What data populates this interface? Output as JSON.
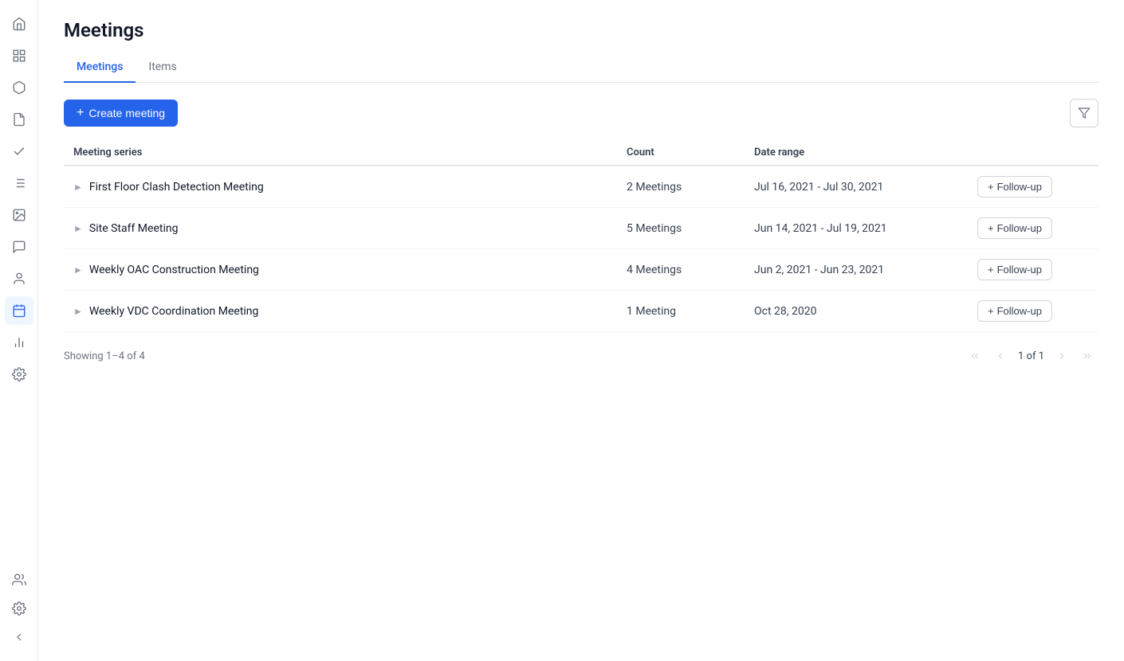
{
  "page": {
    "title": "Meetings"
  },
  "tabs": [
    {
      "id": "meetings",
      "label": "Meetings",
      "active": true
    },
    {
      "id": "items",
      "label": "Items",
      "active": false
    }
  ],
  "toolbar": {
    "create_button_label": "Create meeting",
    "create_button_icon": "+",
    "filter_icon": "filter"
  },
  "table": {
    "columns": [
      {
        "id": "meeting_series",
        "label": "Meeting series"
      },
      {
        "id": "count",
        "label": "Count"
      },
      {
        "id": "date_range",
        "label": "Date range"
      },
      {
        "id": "action",
        "label": ""
      }
    ],
    "rows": [
      {
        "id": 1,
        "name": "First Floor Clash Detection Meeting",
        "count": "2 Meetings",
        "date_range": "Jul 16, 2021 - Jul 30, 2021",
        "action_label": "Follow-up"
      },
      {
        "id": 2,
        "name": "Site Staff Meeting",
        "count": "5 Meetings",
        "date_range": "Jun 14, 2021 - Jul 19, 2021",
        "action_label": "Follow-up"
      },
      {
        "id": 3,
        "name": "Weekly OAC Construction Meeting",
        "count": "4 Meetings",
        "date_range": "Jun 2, 2021 - Jun 23, 2021",
        "action_label": "Follow-up"
      },
      {
        "id": 4,
        "name": "Weekly VDC Coordination Meeting",
        "count": "1 Meeting",
        "date_range": "Oct 28, 2020",
        "action_label": "Follow-up"
      }
    ]
  },
  "footer": {
    "showing_text": "Showing 1–4 of 4",
    "page_info": "1 of 1"
  },
  "sidebar": {
    "icons": [
      {
        "name": "home",
        "glyph": "⊞",
        "active": false
      },
      {
        "name": "grid",
        "glyph": "▦",
        "active": false
      },
      {
        "name": "box",
        "glyph": "◱",
        "active": false
      },
      {
        "name": "document",
        "glyph": "📄",
        "active": false
      },
      {
        "name": "checkmark",
        "glyph": "✓",
        "active": false
      },
      {
        "name": "list",
        "glyph": "☰",
        "active": false
      },
      {
        "name": "image",
        "glyph": "⊡",
        "active": false
      },
      {
        "name": "comment",
        "glyph": "💬",
        "active": false
      },
      {
        "name": "person",
        "glyph": "👤",
        "active": false
      },
      {
        "name": "calendar",
        "glyph": "📅",
        "active": true
      },
      {
        "name": "chart",
        "glyph": "📈",
        "active": false
      },
      {
        "name": "settings-cog",
        "glyph": "⚙",
        "active": false
      },
      {
        "name": "team",
        "glyph": "👥",
        "active": false
      },
      {
        "name": "gear",
        "glyph": "⚙",
        "active": false
      }
    ]
  }
}
